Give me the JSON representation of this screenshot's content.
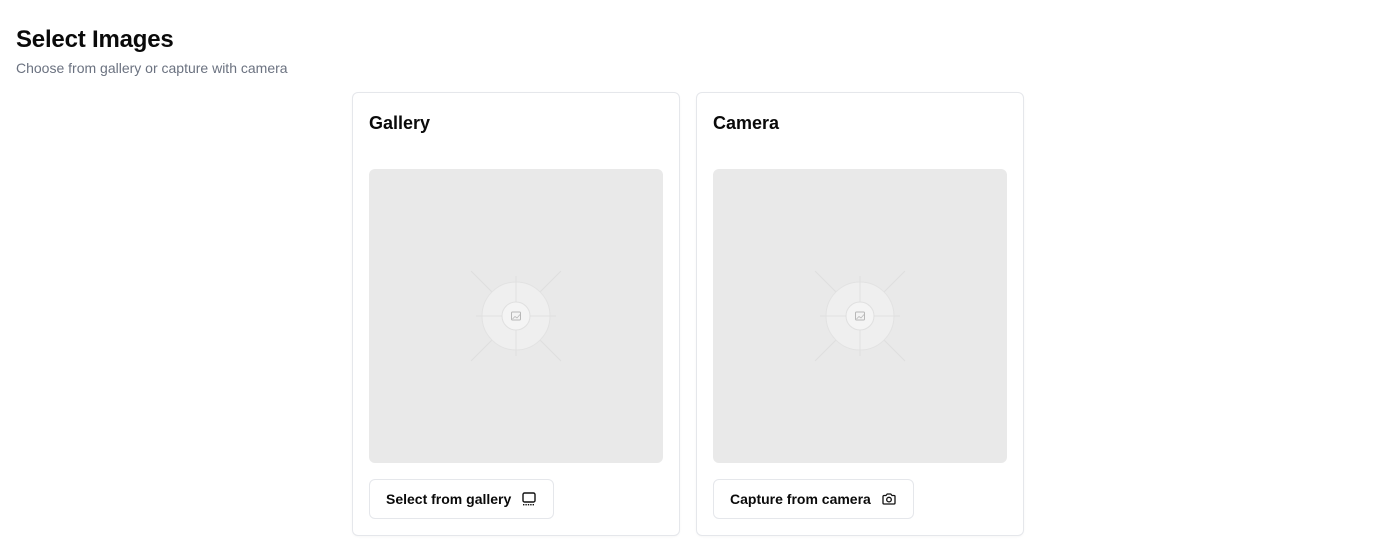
{
  "header": {
    "title": "Select Images",
    "subtitle": "Choose from gallery or capture with camera"
  },
  "cards": [
    {
      "title": "Gallery",
      "button_label": "Select from gallery",
      "button_icon": "gallery-icon",
      "placeholder_icon": "image-placeholder-icon"
    },
    {
      "title": "Camera",
      "button_label": "Capture from camera",
      "button_icon": "camera-icon",
      "placeholder_icon": "image-placeholder-icon"
    }
  ],
  "colors": {
    "preview_bg": "#e9e9e9",
    "border": "#e5e7eb",
    "subtitle": "#6b7280"
  }
}
